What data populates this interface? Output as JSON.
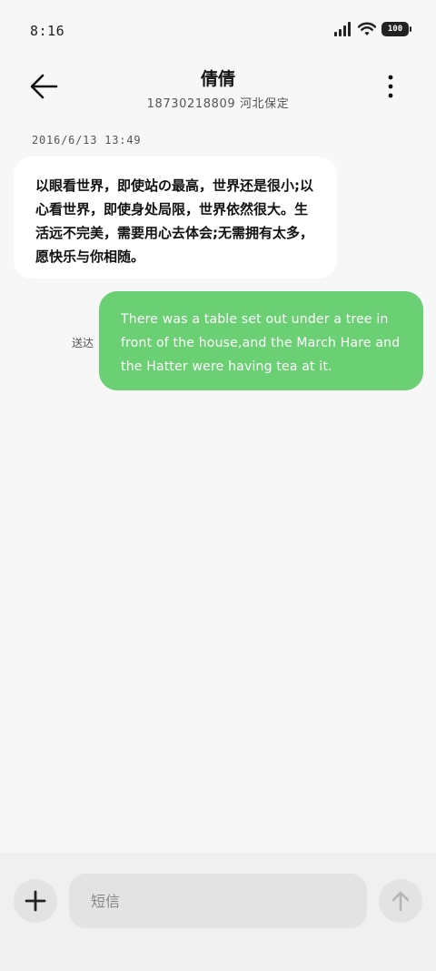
{
  "status_bar": {
    "time": "8:16",
    "battery": "100",
    "icons": [
      "signal-icon",
      "wifi-icon",
      "battery-icon"
    ]
  },
  "header": {
    "contact_name": "倩倩",
    "contact_sub": "18730218809 河北保定",
    "back_icon": "back-arrow-icon",
    "more_icon": "more-vertical-icon"
  },
  "conversation": {
    "timestamp": "2016/6/13 13:49",
    "messages": [
      {
        "direction": "incoming",
        "text": "以眼看世界，即使站の最高，世界还是很小;以心看世界，即使身处局限，世界依然很大。生活远不完美，需要用心去体会;无需拥有太多，愿快乐与你相随。"
      },
      {
        "direction": "outgoing",
        "text": "There was a table set out under a tree in front of the house,and the March Hare and the Hatter were having tea at it.",
        "status": "送达"
      }
    ]
  },
  "composer": {
    "placeholder": "短信",
    "add_icon": "plus-icon",
    "send_icon": "send-arrow-icon"
  },
  "colors": {
    "outgoing_bubble": "#6bcf74",
    "incoming_bubble": "#ffffff",
    "background": "#f7f7f7"
  }
}
